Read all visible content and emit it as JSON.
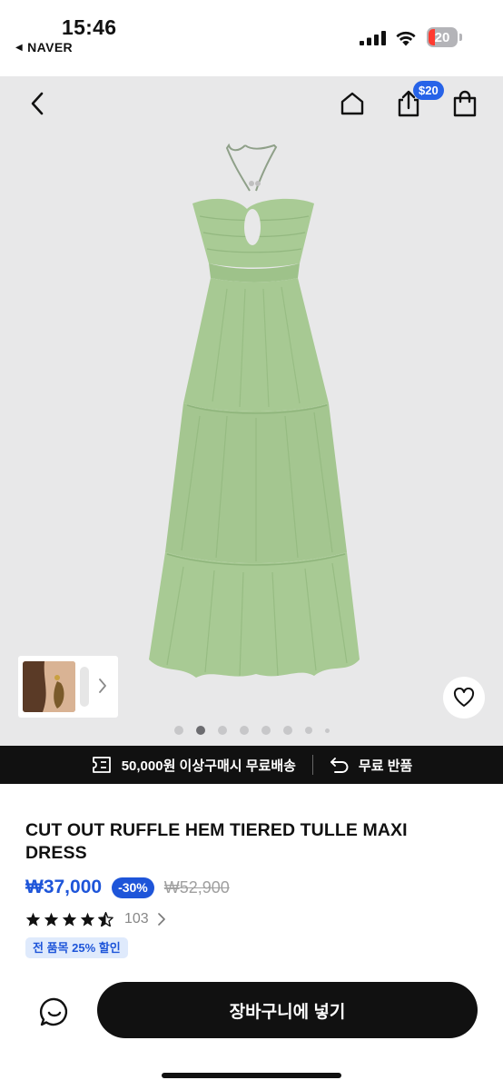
{
  "status_bar": {
    "time": "15:46",
    "back_app": "NAVER",
    "battery_level": "20"
  },
  "header": {
    "share_badge": "$20",
    "icons": [
      "back-icon",
      "home-icon",
      "share-icon",
      "shopping-bag-icon"
    ]
  },
  "gallery": {
    "page_count": 8,
    "active_index": 1,
    "wishlist_icon": "heart-icon"
  },
  "banner": {
    "shipping_text": "50,000원 이상구매시 무료배송",
    "return_text": "무료 반품"
  },
  "product": {
    "title": "CUT OUT RUFFLE HEM TIERED TULLE MAXI DRESS",
    "price": "₩37,000",
    "discount": "-30%",
    "original_price": "₩52,900",
    "rating": 4.5,
    "review_count": "103",
    "promo": "전 품목 25% 할인"
  },
  "bottom_bar": {
    "cart_label": "장바구니에 넣기",
    "chat_icon": "chat-icon"
  },
  "colors": {
    "accent_blue": "#1e55d9",
    "badge_blue": "#2763e8",
    "dark": "#111111",
    "dress_green": "#a7c993"
  }
}
